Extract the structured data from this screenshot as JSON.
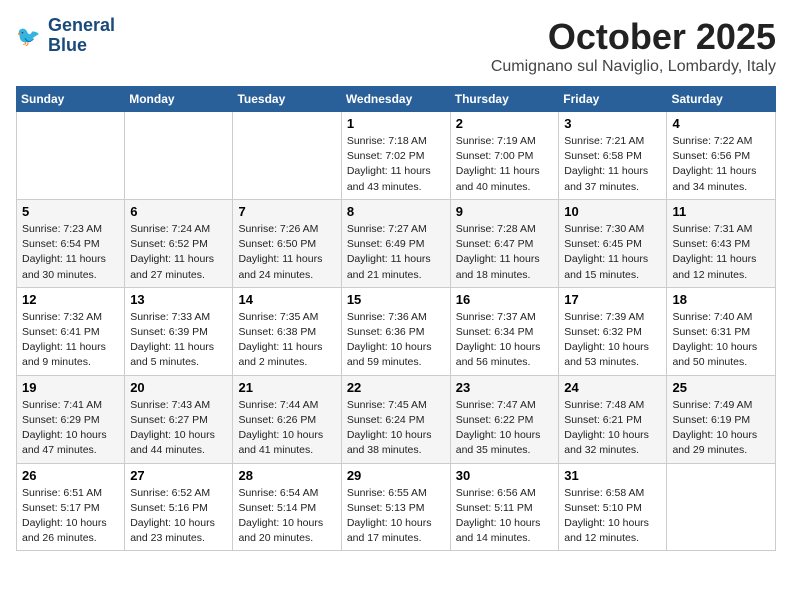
{
  "header": {
    "logo_line1": "General",
    "logo_line2": "Blue",
    "month": "October 2025",
    "location": "Cumignano sul Naviglio, Lombardy, Italy"
  },
  "days_of_week": [
    "Sunday",
    "Monday",
    "Tuesday",
    "Wednesday",
    "Thursday",
    "Friday",
    "Saturday"
  ],
  "weeks": [
    [
      {
        "day": "",
        "info": ""
      },
      {
        "day": "",
        "info": ""
      },
      {
        "day": "",
        "info": ""
      },
      {
        "day": "1",
        "info": "Sunrise: 7:18 AM\nSunset: 7:02 PM\nDaylight: 11 hours\nand 43 minutes."
      },
      {
        "day": "2",
        "info": "Sunrise: 7:19 AM\nSunset: 7:00 PM\nDaylight: 11 hours\nand 40 minutes."
      },
      {
        "day": "3",
        "info": "Sunrise: 7:21 AM\nSunset: 6:58 PM\nDaylight: 11 hours\nand 37 minutes."
      },
      {
        "day": "4",
        "info": "Sunrise: 7:22 AM\nSunset: 6:56 PM\nDaylight: 11 hours\nand 34 minutes."
      }
    ],
    [
      {
        "day": "5",
        "info": "Sunrise: 7:23 AM\nSunset: 6:54 PM\nDaylight: 11 hours\nand 30 minutes."
      },
      {
        "day": "6",
        "info": "Sunrise: 7:24 AM\nSunset: 6:52 PM\nDaylight: 11 hours\nand 27 minutes."
      },
      {
        "day": "7",
        "info": "Sunrise: 7:26 AM\nSunset: 6:50 PM\nDaylight: 11 hours\nand 24 minutes."
      },
      {
        "day": "8",
        "info": "Sunrise: 7:27 AM\nSunset: 6:49 PM\nDaylight: 11 hours\nand 21 minutes."
      },
      {
        "day": "9",
        "info": "Sunrise: 7:28 AM\nSunset: 6:47 PM\nDaylight: 11 hours\nand 18 minutes."
      },
      {
        "day": "10",
        "info": "Sunrise: 7:30 AM\nSunset: 6:45 PM\nDaylight: 11 hours\nand 15 minutes."
      },
      {
        "day": "11",
        "info": "Sunrise: 7:31 AM\nSunset: 6:43 PM\nDaylight: 11 hours\nand 12 minutes."
      }
    ],
    [
      {
        "day": "12",
        "info": "Sunrise: 7:32 AM\nSunset: 6:41 PM\nDaylight: 11 hours\nand 9 minutes."
      },
      {
        "day": "13",
        "info": "Sunrise: 7:33 AM\nSunset: 6:39 PM\nDaylight: 11 hours\nand 5 minutes."
      },
      {
        "day": "14",
        "info": "Sunrise: 7:35 AM\nSunset: 6:38 PM\nDaylight: 11 hours\nand 2 minutes."
      },
      {
        "day": "15",
        "info": "Sunrise: 7:36 AM\nSunset: 6:36 PM\nDaylight: 10 hours\nand 59 minutes."
      },
      {
        "day": "16",
        "info": "Sunrise: 7:37 AM\nSunset: 6:34 PM\nDaylight: 10 hours\nand 56 minutes."
      },
      {
        "day": "17",
        "info": "Sunrise: 7:39 AM\nSunset: 6:32 PM\nDaylight: 10 hours\nand 53 minutes."
      },
      {
        "day": "18",
        "info": "Sunrise: 7:40 AM\nSunset: 6:31 PM\nDaylight: 10 hours\nand 50 minutes."
      }
    ],
    [
      {
        "day": "19",
        "info": "Sunrise: 7:41 AM\nSunset: 6:29 PM\nDaylight: 10 hours\nand 47 minutes."
      },
      {
        "day": "20",
        "info": "Sunrise: 7:43 AM\nSunset: 6:27 PM\nDaylight: 10 hours\nand 44 minutes."
      },
      {
        "day": "21",
        "info": "Sunrise: 7:44 AM\nSunset: 6:26 PM\nDaylight: 10 hours\nand 41 minutes."
      },
      {
        "day": "22",
        "info": "Sunrise: 7:45 AM\nSunset: 6:24 PM\nDaylight: 10 hours\nand 38 minutes."
      },
      {
        "day": "23",
        "info": "Sunrise: 7:47 AM\nSunset: 6:22 PM\nDaylight: 10 hours\nand 35 minutes."
      },
      {
        "day": "24",
        "info": "Sunrise: 7:48 AM\nSunset: 6:21 PM\nDaylight: 10 hours\nand 32 minutes."
      },
      {
        "day": "25",
        "info": "Sunrise: 7:49 AM\nSunset: 6:19 PM\nDaylight: 10 hours\nand 29 minutes."
      }
    ],
    [
      {
        "day": "26",
        "info": "Sunrise: 6:51 AM\nSunset: 5:17 PM\nDaylight: 10 hours\nand 26 minutes."
      },
      {
        "day": "27",
        "info": "Sunrise: 6:52 AM\nSunset: 5:16 PM\nDaylight: 10 hours\nand 23 minutes."
      },
      {
        "day": "28",
        "info": "Sunrise: 6:54 AM\nSunset: 5:14 PM\nDaylight: 10 hours\nand 20 minutes."
      },
      {
        "day": "29",
        "info": "Sunrise: 6:55 AM\nSunset: 5:13 PM\nDaylight: 10 hours\nand 17 minutes."
      },
      {
        "day": "30",
        "info": "Sunrise: 6:56 AM\nSunset: 5:11 PM\nDaylight: 10 hours\nand 14 minutes."
      },
      {
        "day": "31",
        "info": "Sunrise: 6:58 AM\nSunset: 5:10 PM\nDaylight: 10 hours\nand 12 minutes."
      },
      {
        "day": "",
        "info": ""
      }
    ]
  ]
}
